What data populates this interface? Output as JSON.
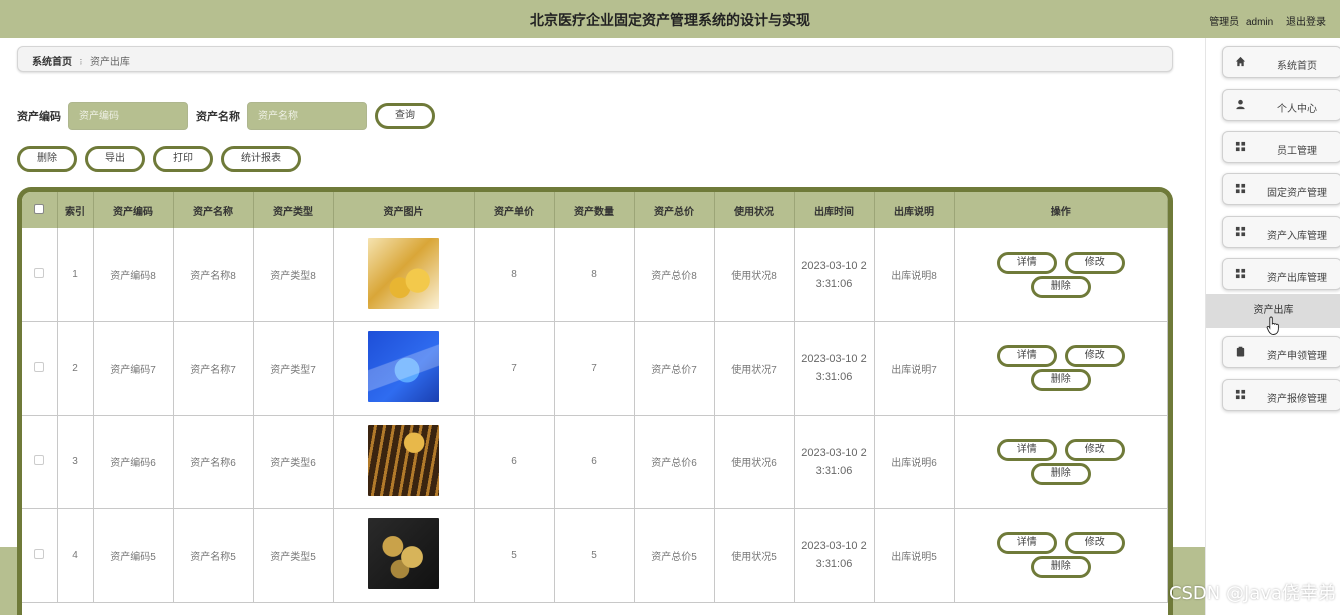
{
  "header": {
    "title": "北京医疗企业固定资产管理系统的设计与实现",
    "user_role": "管理员",
    "username": "admin",
    "logout": "退出登录"
  },
  "breadcrumb": {
    "home": "系统首页",
    "separator": "፧",
    "current": "资产出库"
  },
  "search": {
    "code_label": "资产编码",
    "code_placeholder": "资产编码",
    "name_label": "资产名称",
    "name_placeholder": "资产名称",
    "query_button": "查询"
  },
  "actions": {
    "delete": "删除",
    "export": "导出",
    "print": "打印",
    "report": "统计报表"
  },
  "table": {
    "headers": [
      "索引",
      "资产编码",
      "资产名称",
      "资产类型",
      "资产图片",
      "资产单价",
      "资产数量",
      "资产总价",
      "使用状况",
      "出库时间",
      "出库说明",
      "操作"
    ],
    "ops": {
      "detail": "详情",
      "edit": "修改",
      "delete": "删除"
    },
    "rows": [
      {
        "index": "1",
        "code": "资产编码8",
        "name": "资产名称8",
        "type": "资产类型8",
        "price": "8",
        "qty": "8",
        "total": "资产总价8",
        "status": "使用状况8",
        "time_a": "2023-03-10 2",
        "time_b": "3:31:06",
        "note": "出库说明8",
        "thumb_icon": "gold-coins-photo"
      },
      {
        "index": "2",
        "code": "资产编码7",
        "name": "资产名称7",
        "type": "资产类型7",
        "price": "7",
        "qty": "7",
        "total": "资产总价7",
        "status": "使用状况7",
        "time_a": "2023-03-10 2",
        "time_b": "3:31:06",
        "note": "出库说明7",
        "thumb_icon": "laptop-finance-illustration"
      },
      {
        "index": "3",
        "code": "资产编码6",
        "name": "资产名称6",
        "type": "资产类型6",
        "price": "6",
        "qty": "6",
        "total": "资产总价6",
        "status": "使用状况6",
        "time_a": "2023-03-10 2",
        "time_b": "3:31:06",
        "note": "出库说明6",
        "thumb_icon": "coin-stack-photo"
      },
      {
        "index": "4",
        "code": "资产编码5",
        "name": "资产名称5",
        "type": "资产类型5",
        "price": "5",
        "qty": "5",
        "total": "资产总价5",
        "status": "使用状况5",
        "time_a": "2023-03-10 2",
        "time_b": "3:31:06",
        "note": "出库说明5",
        "thumb_icon": "bitcoin-photo"
      }
    ]
  },
  "sidebar": {
    "items": [
      {
        "label": "系统首页",
        "icon": "home-icon"
      },
      {
        "label": "个人中心",
        "icon": "user-icon"
      },
      {
        "label": "员工管理",
        "icon": "grid-icon"
      },
      {
        "label": "固定资产管理",
        "icon": "grid-icon"
      },
      {
        "label": "资产入库管理",
        "icon": "grid-icon"
      },
      {
        "label": "资产出库管理",
        "icon": "grid-icon"
      },
      {
        "label": "资产申领管理",
        "icon": "clipboard-icon"
      },
      {
        "label": "资产报修管理",
        "icon": "grid-icon"
      }
    ],
    "active_sub": "资产出库"
  },
  "watermark": "CSDN @Java侥幸弟",
  "colors": {
    "accent": "#b6bf90",
    "border_dark": "#6f7a39"
  }
}
